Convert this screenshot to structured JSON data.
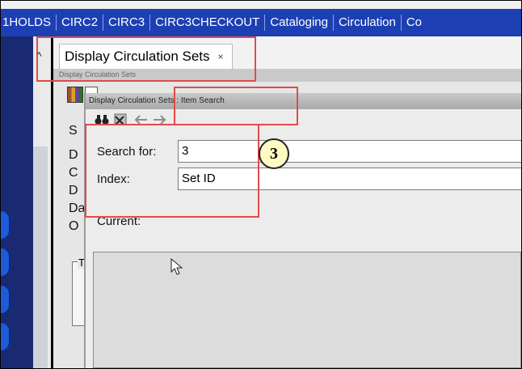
{
  "menu": {
    "items": [
      "1HOLDS",
      "CIRC2",
      "CIRC3",
      "CIRC3CHECKOUT",
      "Cataloging",
      "Circulation",
      "Co"
    ]
  },
  "tab": {
    "label": "Display Circulation Sets",
    "close": "×",
    "subtitle": "Display Circulation Sets"
  },
  "background_form": {
    "label_fragments": [
      "S",
      "D",
      "C",
      "D",
      "Da",
      "O"
    ],
    "group_label": "T"
  },
  "dialog": {
    "title": "Display Circulation Sets : Item Search",
    "toolbar_icons": [
      "binoculars-icon",
      "clear-icon",
      "back-arrow-icon",
      "forward-arrow-icon"
    ],
    "search_for": {
      "label": "Search for:",
      "value": "3"
    },
    "index": {
      "label": "Index:",
      "value": "Set ID"
    },
    "current_label": "Current:"
  },
  "annotation": {
    "step_number": "3",
    "color": "#e24a4a",
    "badge_color": "#fff9c2"
  },
  "colors": {
    "menubar": "#1d3fb4",
    "leftstrip": "#1a2a72"
  }
}
